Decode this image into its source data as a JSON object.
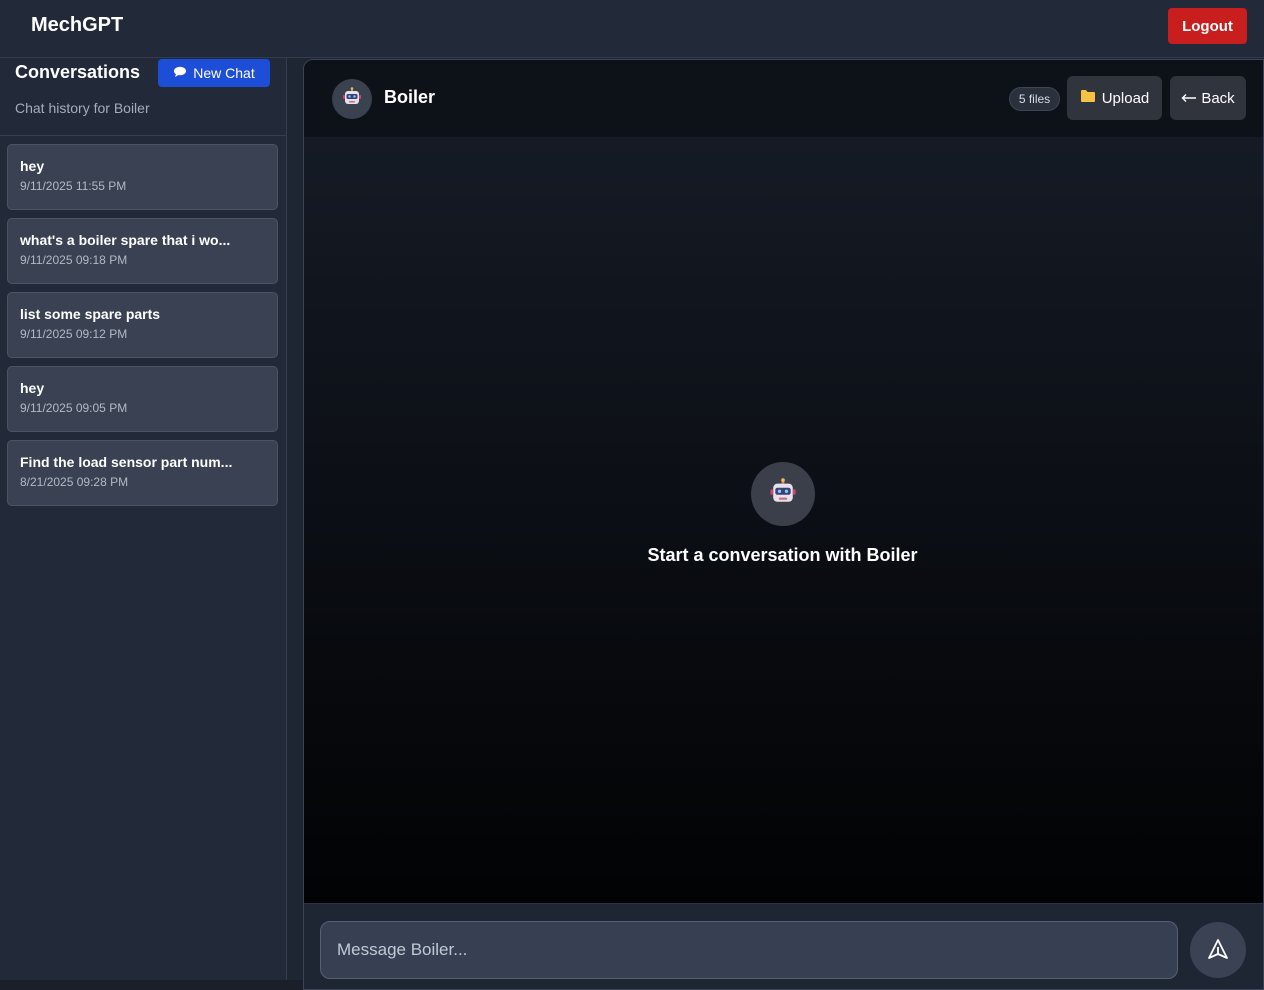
{
  "app": {
    "brand": "MechGPT",
    "logout_label": "Logout"
  },
  "sidebar": {
    "title": "Conversations",
    "new_chat_label": "New Chat",
    "subtitle": "Chat history for Boiler",
    "conversations": [
      {
        "title": "hey",
        "date": "9/11/2025 11:55 PM"
      },
      {
        "title": "what's a boiler spare that i wo...",
        "date": "9/11/2025 09:18 PM"
      },
      {
        "title": "list some spare parts",
        "date": "9/11/2025 09:12 PM"
      },
      {
        "title": "hey",
        "date": "9/11/2025 09:05 PM"
      },
      {
        "title": "Find the load sensor part num...",
        "date": "8/21/2025 09:28 PM"
      }
    ]
  },
  "chat": {
    "bot_name": "Boiler",
    "files_badge": "5 files",
    "upload_label": "Upload",
    "back_label": "Back",
    "empty_state": "Start a conversation with Boiler",
    "input_placeholder": "Message Boiler...",
    "input_value": ""
  },
  "icons": {
    "bot": "robot-icon",
    "new_chat": "speech-bubble-icon",
    "upload": "folder-icon",
    "back": "arrow-left-icon",
    "send": "send-icon"
  },
  "colors": {
    "logout": "#c81e1e",
    "new_chat": "#1d4ed8",
    "folder": "#f5c242"
  }
}
